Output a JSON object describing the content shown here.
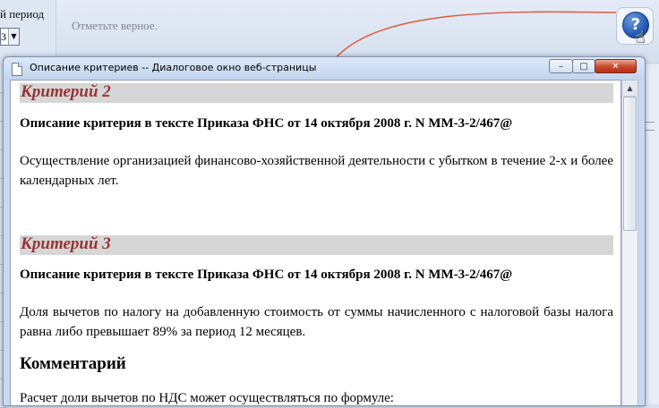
{
  "background": {
    "period_label": "й период",
    "period_select_value": "3",
    "instruction": "Отметьте верное.",
    "help_icon_glyph": "?"
  },
  "dialog": {
    "title": "Описание критериев -- Диалоговое окно веб-страницы",
    "controls": {
      "minimize": "–",
      "maximize": "□",
      "close": "✕"
    },
    "criteria": [
      {
        "heading": "Критерий 2",
        "subheading": "Описание критерия в тексте Приказа ФНС от 14 октября 2008 г. N ММ-3-2/467@",
        "text": "Осуществление организацией финансово-хозяйственной деятельности с убытком в течение 2-х и более календарных лет."
      },
      {
        "heading": "Критерий 3",
        "subheading": "Описание критерия в тексте Приказа ФНС от 14 октября 2008 г. N ММ-3-2/467@",
        "text": "Доля вычетов по налогу на добавленную стоимость от суммы начисленного с налоговой базы налога равна либо превышает 89% за период 12 месяцев."
      }
    ],
    "comment": {
      "heading": "Комментарий",
      "text": "Расчет доли вычетов по НДС может осуществляться по формуле:"
    }
  },
  "colors": {
    "criterion_heading": "#983434",
    "heading_band": "#d6d6d6",
    "arrow": "#e05a3a"
  }
}
